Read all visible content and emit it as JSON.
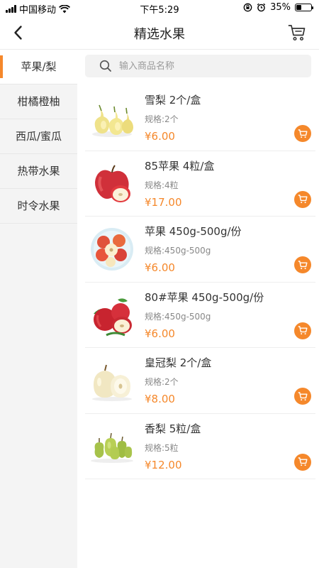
{
  "status_bar": {
    "carrier": "中国移动",
    "time": "下午5:29",
    "battery_text": "35%",
    "battery_level": 0.35
  },
  "nav": {
    "title": "精选水果",
    "back_icon": "chevron-left-icon",
    "cart_icon": "cart-icon"
  },
  "sidebar": {
    "items": [
      {
        "label": "苹果/梨",
        "active": true
      },
      {
        "label": "柑橘橙柚",
        "active": false
      },
      {
        "label": "西瓜/蜜瓜",
        "active": false
      },
      {
        "label": "热带水果",
        "active": false
      },
      {
        "label": "时令水果",
        "active": false
      }
    ]
  },
  "search": {
    "placeholder": "输入商品名称",
    "value": ""
  },
  "products": [
    {
      "name": "雪梨 2个/盒",
      "spec": "规格:2个",
      "price": "¥6.00",
      "image": "snow-pear"
    },
    {
      "name": "85苹果 4粒/盒",
      "spec": "规格:4粒",
      "price": "¥17.00",
      "image": "red-apple"
    },
    {
      "name": "苹果 450g-500g/份",
      "spec": "规格:450g-500g",
      "price": "¥6.00",
      "image": "apple-bowl"
    },
    {
      "name": "80#苹果 450g-500g/份",
      "spec": "规格:450g-500g",
      "price": "¥6.00",
      "image": "red-apples-leaf"
    },
    {
      "name": "皇冠梨 2个/盒",
      "spec": "规格:2个",
      "price": "¥8.00",
      "image": "crown-pear"
    },
    {
      "name": "香梨 5粒/盒",
      "spec": "规格:5粒",
      "price": "¥12.00",
      "image": "fragrant-pear"
    }
  ],
  "colors": {
    "accent": "#f5882b",
    "sidebar_bg": "#f4f4f4",
    "search_bg": "#f2f2f2"
  }
}
